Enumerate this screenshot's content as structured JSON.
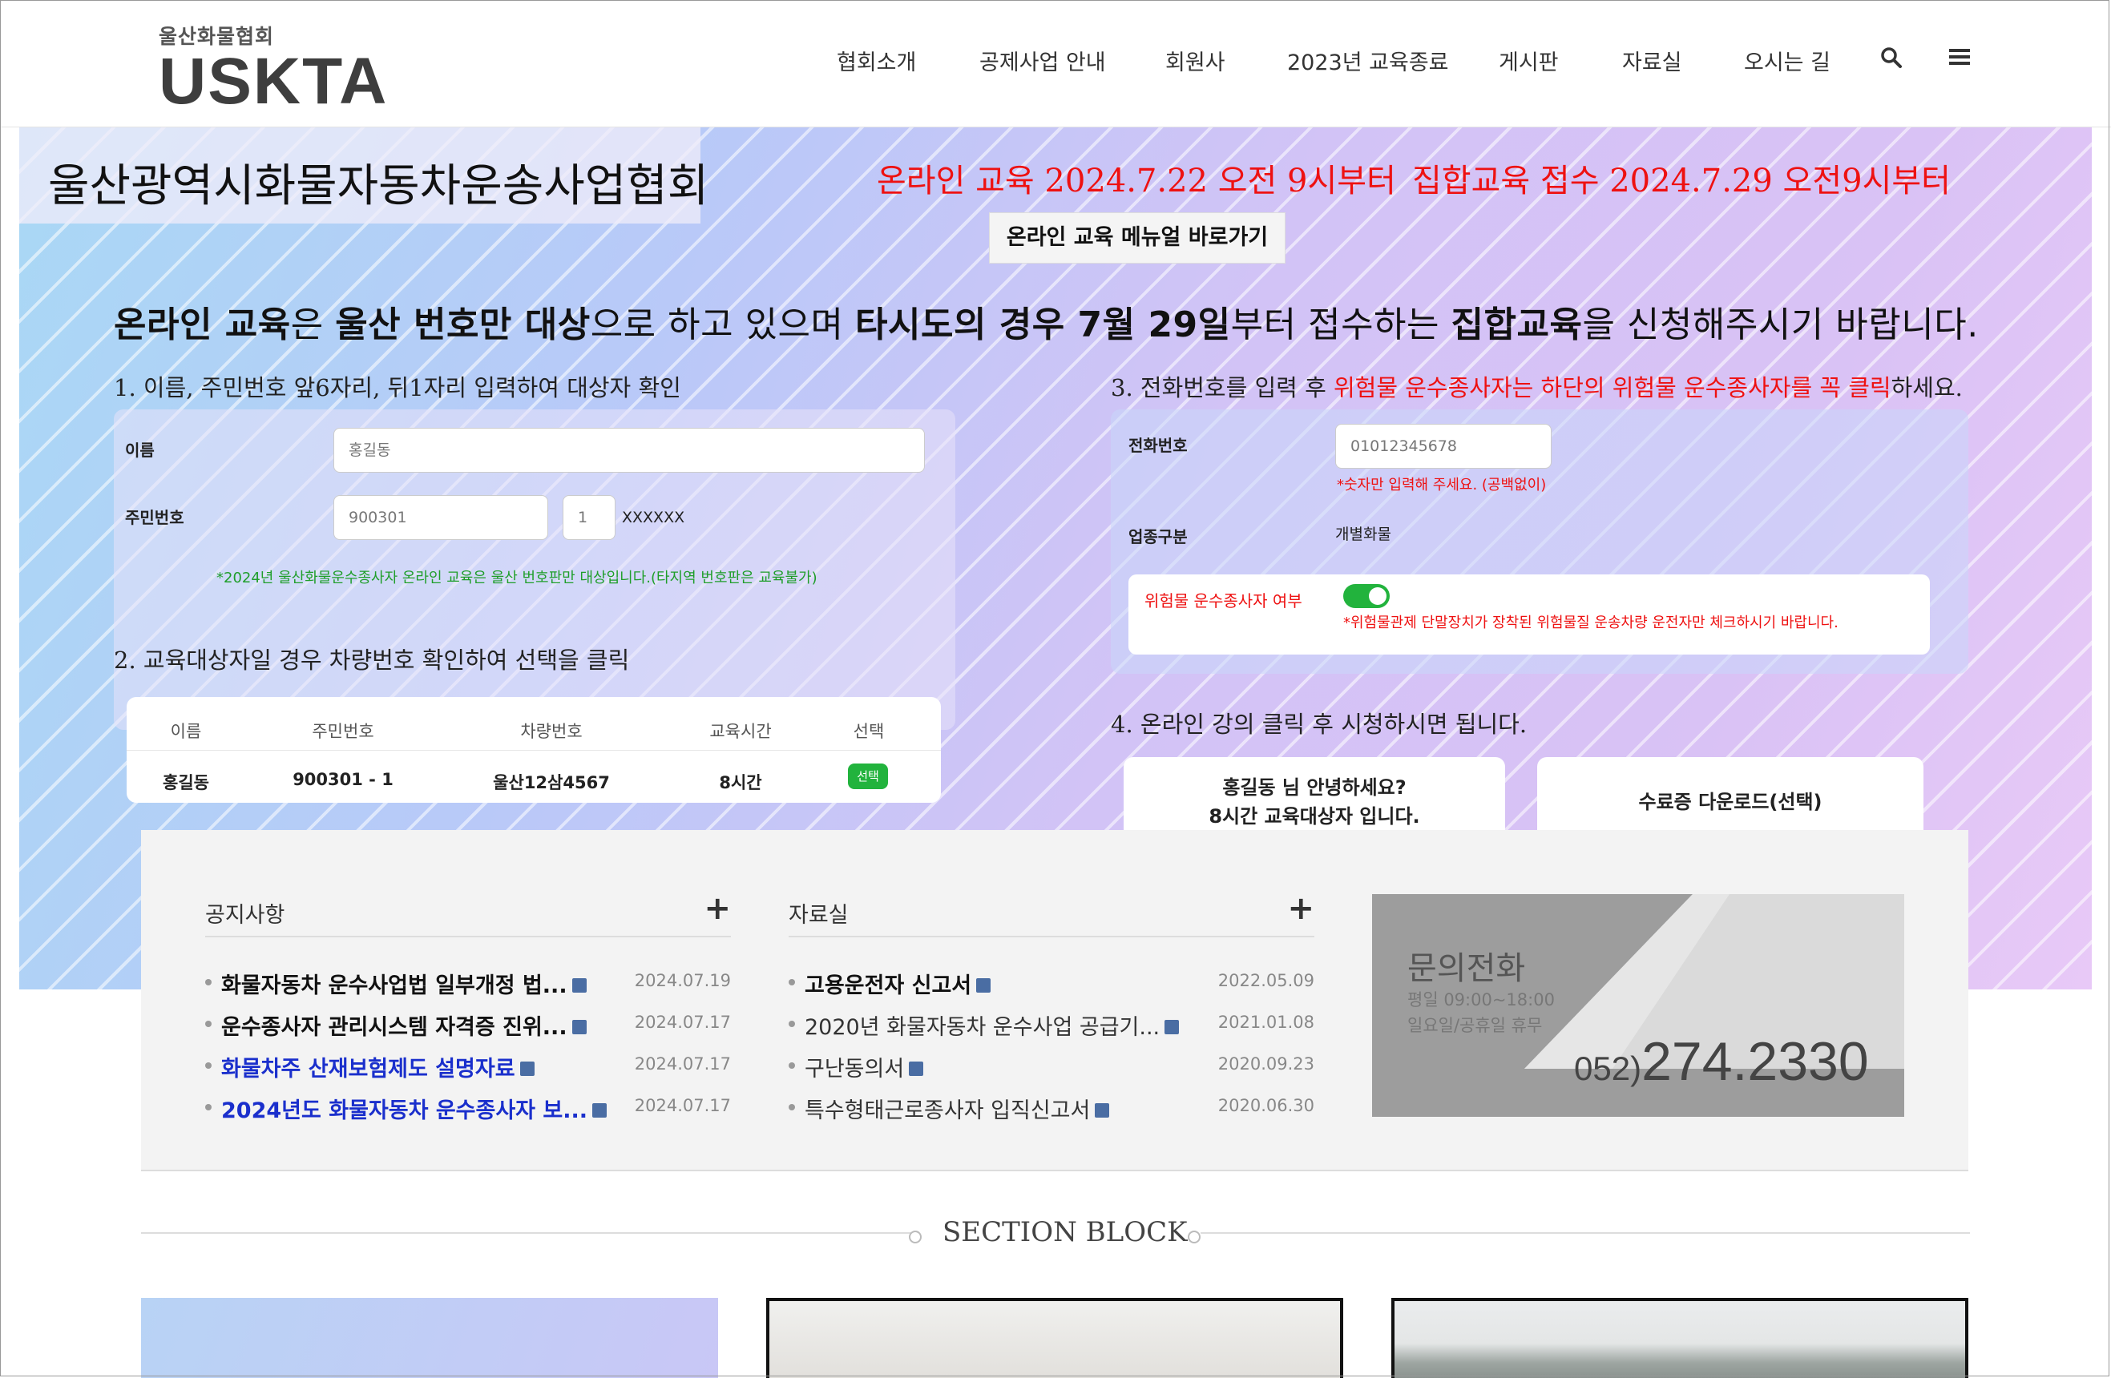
{
  "header": {
    "logo_sub": "울산화물협회",
    "logo_main": "USKTA",
    "nav": [
      "협회소개",
      "공제사업 안내",
      "회원사",
      "2023년 교육종료",
      "게시판",
      "자료실",
      "오시는 길"
    ],
    "icons": [
      "search-icon",
      "menu-icon"
    ]
  },
  "hero": {
    "title": "울산광역시화물자동차운송사업협회",
    "announce_online": "온라인 교육 2024.7.22 오전 9시부터",
    "announce_group": "집합교육 접수 2024.7.29 오전9시부터",
    "manual_button": "온라인 교육 메뉴얼 바로가기",
    "notice": {
      "p1": "온라인 교육",
      "p2": "은 ",
      "p3": "울산 번호만 대상",
      "p4": "으로 하고 있으며 ",
      "p5": "타시도의 경우 7월 29일",
      "p6": "부터 접수하는 ",
      "p7": "집합교육",
      "p8": "을 신청해주시기 바랍니다."
    },
    "step1": "1. 이름, 주민번호 앞6자리, 뒤1자리 입력하여 대상자 확인",
    "step2": "2. 교육대상자일 경우 차량번호 확인하여 선택을 클릭",
    "step3": {
      "a": "3. 전화번호를 입력 후 ",
      "b": "위험물 운수종사자는 하단의 위험물 운수종사자를 꼭 클릭",
      "c": "하세요."
    },
    "step4": "4. 온라인 강의 클릭 후 시청하시면 됩니다.",
    "form": {
      "name_label": "이름",
      "name_value": "홍길동",
      "rrn_label": "주민번호",
      "rrn_front": "900301",
      "rrn_back": "1",
      "rrn_mask": "XXXXXX",
      "green_note": "*2024년 울산화물운수종사자 온라인 교육은 울산 번호판만 대상입니다.(타지역 번호판은 교육불가)",
      "phone_label": "전화번호",
      "phone_value": "01012345678",
      "phone_note": "*숫자만 입력해 주세요. (공백없이)",
      "type_label": "업종구분",
      "type_value": "개별화물",
      "hazmat_label": "위험물 운수종사자 여부",
      "hazmat_note": "*위험물관제 단말장치가 장착된 위험물질 운송차량 운전자만 체크하시기 바랍니다."
    },
    "table": {
      "headers": [
        "이름",
        "주민번호",
        "차량번호",
        "교육시간",
        "선택"
      ],
      "row": [
        "홍길동",
        "900301 - 1",
        "울산12삼4567",
        "8시간"
      ],
      "select_label": "선택"
    },
    "card_greeting_1": "홍길동 님 안녕하세요?",
    "card_greeting_2": "8시간 교육대상자 입니다.",
    "card_download": "수료증 다운로드(선택)"
  },
  "board": {
    "notice": {
      "title": "공지사항",
      "items": [
        {
          "title": "화물자동차 운수사업법 일부개정 법...",
          "date": "2024.07.19",
          "style": "bold"
        },
        {
          "title": "운수종사자 관리시스템 자격증 진위...",
          "date": "2024.07.17",
          "style": "bold"
        },
        {
          "title": "화물차주 산재보험제도 설명자료",
          "date": "2024.07.17",
          "style": "blue"
        },
        {
          "title": "2024년도 화물자동차 운수종사자 보...",
          "date": "2024.07.17",
          "style": "blue"
        }
      ]
    },
    "archive": {
      "title": "자료실",
      "items": [
        {
          "title": "고용운전자 신고서",
          "date": "2022.05.09",
          "style": "bold"
        },
        {
          "title": "2020년 화물자동차 운수사업 공급기...",
          "date": "2021.01.08",
          "style": "normal"
        },
        {
          "title": "구난동의서",
          "date": "2020.09.23",
          "style": "normal"
        },
        {
          "title": "특수형태근로종사자 입직신고서",
          "date": "2020.06.30",
          "style": "normal"
        }
      ]
    },
    "contact": {
      "title": "문의전화",
      "hours": "평일 09:00~18:00",
      "holiday": "일요일/공휴일 휴무",
      "phone_prefix": "052)",
      "phone_number": "274.2330"
    }
  },
  "section": {
    "title": "SECTION BLOCK"
  },
  "colors": {
    "red": "#ee1111",
    "green": "#22b33d",
    "blue_link": "#1a2fcc"
  }
}
